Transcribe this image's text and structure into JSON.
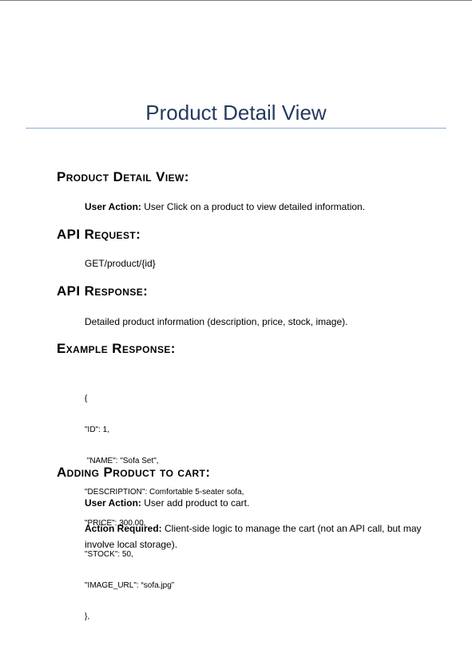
{
  "document": {
    "title": "Product Detail View"
  },
  "sections": {
    "product_detail": {
      "heading": "Product Detail View:",
      "user_action_label": "User Action:",
      "user_action_text": " User Click on a product to view detailed information."
    },
    "api_request": {
      "heading": "API Request:",
      "text": "GET/product/{id}"
    },
    "api_response": {
      "heading": "API Response:",
      "text": "Detailed product information (description, price, stock, image)."
    },
    "example_response": {
      "heading": "Example Response:",
      "lines": [
        "{",
        "\"ID\": 1,",
        " \"NAME\": \"Sofa Set\",",
        "\"DESCRIPTION\": Comfortable 5-seater sofa,",
        "\"PRICE\": 300.00,",
        "\"STOCK\": 50,",
        "\"IMAGE_URL\": “sofa.jpg”",
        "},"
      ]
    },
    "adding_to_cart": {
      "heading": "Adding Product to cart:",
      "user_action_label": "User Action:",
      "user_action_text": " User add product to cart.",
      "action_required_label": "Action Required:",
      "action_required_text": " Client-side logic to manage the cart (not an API call, but may involve local storage)."
    }
  }
}
